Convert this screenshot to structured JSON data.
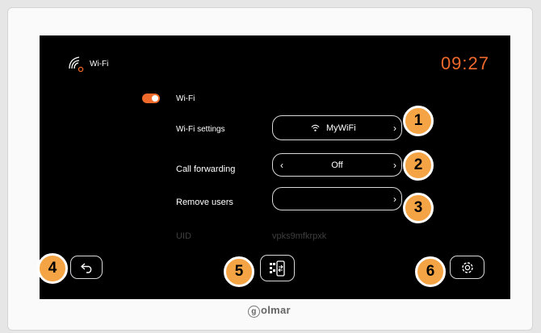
{
  "header": {
    "wifi_label": "Wi-Fi",
    "time": "09:27"
  },
  "wifi_toggle": {
    "label": "Wi-Fi",
    "on": true
  },
  "wifi_settings": {
    "label": "Wi-Fi settings",
    "value": "MyWiFi"
  },
  "call_forwarding": {
    "label": "Call forwarding",
    "value": "Off"
  },
  "remove_users": {
    "label": "Remove users",
    "value": ""
  },
  "uid": {
    "label": "UID",
    "value": "vpks9mfkrpxk"
  },
  "callouts": [
    "1",
    "2",
    "3",
    "4",
    "5",
    "6"
  ],
  "icons": {
    "status": "wifi-status-icon",
    "back": "back-arrow-icon",
    "qr": "qr-code-icon",
    "settings": "gear-icon"
  },
  "brand": {
    "name": "olmar",
    "initial": "g"
  },
  "colors": {
    "accent": "#f06a2c",
    "callout": "#f5a445",
    "screen": "#000000"
  }
}
